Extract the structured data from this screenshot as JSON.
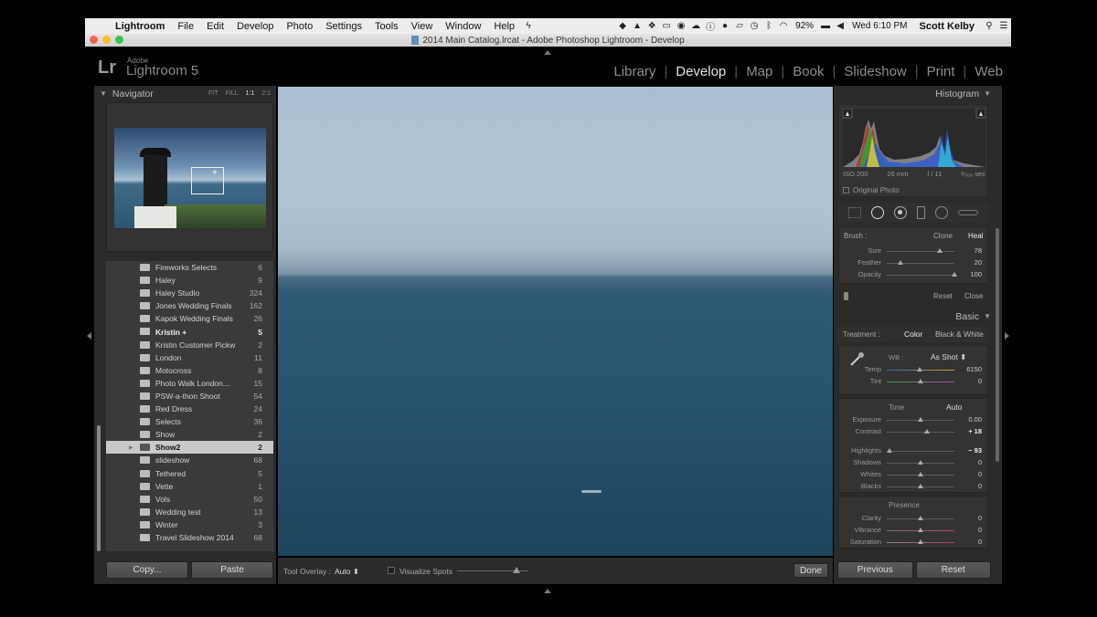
{
  "menubar": {
    "apple": "",
    "app": "Lightroom",
    "items": [
      "File",
      "Edit",
      "Develop",
      "Photo",
      "Settings",
      "Tools",
      "View",
      "Window",
      "Help"
    ],
    "battery": "92%",
    "clock": "Wed 6:10 PM",
    "user": "Scott Kelby"
  },
  "window": {
    "title": "2014 Main Catalog.lrcat - Adobe Photoshop Lightroom - Develop"
  },
  "identity": {
    "logo": "Lr",
    "brand_small": "Adobe",
    "brand": "Lightroom 5"
  },
  "modules": [
    "Library",
    "Develop",
    "Map",
    "Book",
    "Slideshow",
    "Print",
    "Web"
  ],
  "active_module": "Develop",
  "navigator": {
    "title": "Navigator",
    "options": [
      "FIT",
      "FILL",
      "1:1",
      "2:1"
    ],
    "active_option": "1:1"
  },
  "folders": [
    {
      "name": "Fireworks Selects",
      "count": "6"
    },
    {
      "name": "Haley",
      "count": "9"
    },
    {
      "name": "Haley Studio",
      "count": "324"
    },
    {
      "name": "Jones Wedding Finals",
      "count": "162"
    },
    {
      "name": "Kapok Wedding Finals",
      "count": "26"
    },
    {
      "name": "Kristin  +",
      "count": "5",
      "bold": true
    },
    {
      "name": "Kristin Customer Pickw",
      "count": "2"
    },
    {
      "name": "London",
      "count": "11"
    },
    {
      "name": "Motocross",
      "count": "8"
    },
    {
      "name": "Photo Walk London...",
      "count": "15"
    },
    {
      "name": "PSW-a-thon Shoot",
      "count": "54"
    },
    {
      "name": "Red Dress",
      "count": "24"
    },
    {
      "name": "Selects",
      "count": "36"
    },
    {
      "name": "Show",
      "count": "2"
    },
    {
      "name": "Show2",
      "count": "2",
      "selected": true
    },
    {
      "name": "slideshow",
      "count": "68"
    },
    {
      "name": "Tethered",
      "count": "5"
    },
    {
      "name": "Vette",
      "count": "1"
    },
    {
      "name": "Vols",
      "count": "50"
    },
    {
      "name": "Wedding test",
      "count": "13"
    },
    {
      "name": "Winter",
      "count": "3"
    },
    {
      "name": "Travel Slideshow 2014",
      "count": "68"
    }
  ],
  "left_buttons": {
    "copy": "Copy...",
    "paste": "Paste"
  },
  "toolbar": {
    "overlay_label": "Tool Overlay :",
    "overlay_value": "Auto",
    "visualize_label": "Visualize Spots",
    "visualize_level": 0.83,
    "done": "Done"
  },
  "histogram": {
    "title": "Histogram",
    "iso": "ISO 200",
    "focal": "26 mm",
    "aperture": "f / 11",
    "shutter": "¹⁄₅₀₀ sec",
    "original_photo": "Original Photo"
  },
  "spot": {
    "brush_label": "Brush :",
    "clone": "Clone",
    "heal": "Heal",
    "sliders": [
      {
        "label": "Size",
        "value": "78",
        "level": 0.78
      },
      {
        "label": "Feather",
        "value": "20",
        "level": 0.2
      },
      {
        "label": "Opacity",
        "value": "100",
        "level": 1.0
      }
    ],
    "reset": "Reset",
    "close": "Close"
  },
  "basic": {
    "title": "Basic",
    "treatment_label": "Treatment :",
    "color": "Color",
    "bw": "Black & White",
    "wb_label": "WB :",
    "wb_value": "As Shot",
    "wb_sliders": [
      {
        "label": "Temp",
        "value": "6150",
        "level": 0.48
      },
      {
        "label": "Tint",
        "value": "0",
        "level": 0.5
      }
    ],
    "tone_label": "Tone",
    "auto": "Auto",
    "tone_sliders": [
      {
        "label": "Exposure",
        "value": "0.00",
        "level": 0.5
      },
      {
        "label": "Contrast",
        "value": "+ 18",
        "level": 0.59,
        "bold": true
      }
    ],
    "tone_sliders2": [
      {
        "label": "Highlights",
        "value": "− 93",
        "level": 0.04,
        "bold": true
      },
      {
        "label": "Shadows",
        "value": "0",
        "level": 0.5
      },
      {
        "label": "Whites",
        "value": "0",
        "level": 0.5
      },
      {
        "label": "Blacks",
        "value": "0",
        "level": 0.5
      }
    ],
    "presence_label": "Presence",
    "presence_sliders": [
      {
        "label": "Clarity",
        "value": "0",
        "level": 0.5
      },
      {
        "label": "Vibrance",
        "value": "0",
        "level": 0.5
      },
      {
        "label": "Saturation",
        "value": "0",
        "level": 0.5
      }
    ]
  },
  "right_buttons": {
    "previous": "Previous",
    "reset": "Reset"
  }
}
